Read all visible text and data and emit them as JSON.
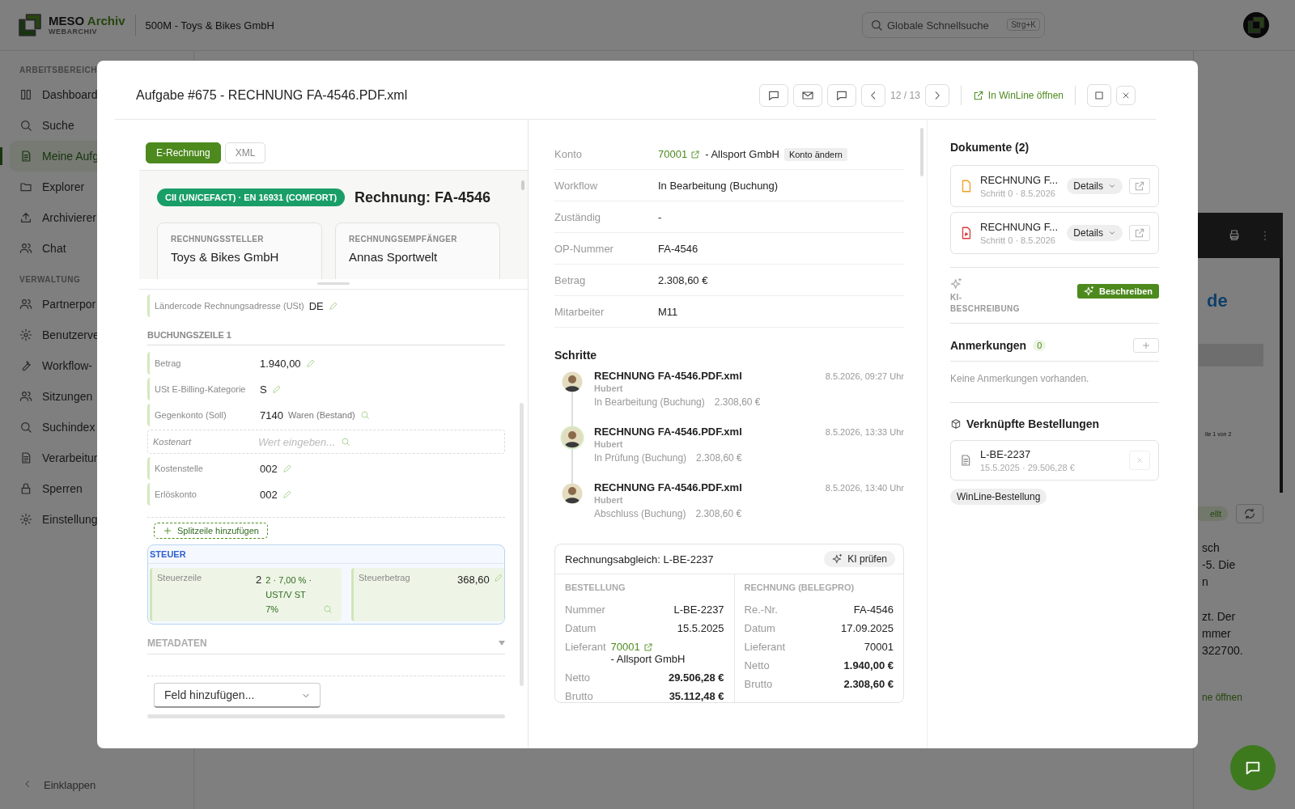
{
  "app": {
    "brand": "MESO",
    "brand_accent": "Archiv",
    "brand_sub": "WEBARCHIV",
    "tenant": "500M - Toys & Bikes GmbH",
    "search": {
      "placeholder": "Globale Schnellsuche",
      "shortcut": "Strg+K"
    }
  },
  "sidebar": {
    "sections": [
      {
        "title": "ARBEITSBEREICH",
        "items": [
          {
            "label": "Dashboard",
            "selected": false
          },
          {
            "label": "Suche",
            "selected": false
          },
          {
            "label": "Meine Aufg",
            "selected": true
          },
          {
            "label": "Explorer",
            "selected": false
          },
          {
            "label": "Archivierer",
            "selected": false
          },
          {
            "label": "Chat",
            "selected": false
          }
        ]
      },
      {
        "title": "VERWALTUNG",
        "items": [
          {
            "label": "Partnerpor",
            "selected": false
          },
          {
            "label": "Benutzerve",
            "selected": false
          },
          {
            "label": "Workflow-",
            "selected": false
          },
          {
            "label": "Sitzungen",
            "selected": false
          },
          {
            "label": "Suchindex",
            "selected": false
          },
          {
            "label": "Verarbeitur",
            "selected": false
          },
          {
            "label": "Sperren",
            "selected": false
          },
          {
            "label": "Einstellung",
            "selected": false
          }
        ]
      }
    ],
    "collapse": "Einklappen"
  },
  "background": {
    "pdf_heading": "de",
    "pdf_footer": "ite 1 von 2",
    "status": "ellt",
    "lines": [
      "sch",
      "-5. Die",
      "n",
      "zt. Der",
      "mmer",
      "322700."
    ],
    "link": "ne öffnen"
  },
  "dialog": {
    "title": "Aufgabe #675 - RECHNUNG FA-4546.PDF.xml",
    "pager": "12 / 13",
    "open_link": "In WinLine öffnen",
    "left": {
      "tabs": [
        {
          "label": "E-Rechnung",
          "selected": true
        },
        {
          "label": "XML",
          "selected": false
        }
      ],
      "standard": "CII (UN/CEFACT) · EN 16931 (COMFORT)",
      "heading": "Rechnung: FA-4546",
      "parties": [
        {
          "label": "RECHNUNGSSTELLER",
          "name": "Toys & Bikes GmbH"
        },
        {
          "label": "RECHNUNGSEMPFÄNGER",
          "name": "Annas Sportwelt"
        }
      ],
      "country": {
        "label": "Ländercode Rechnungsadresse (USt)",
        "value": "DE"
      },
      "booking_title": "BUCHUNGSZEILE 1",
      "fields": [
        {
          "kind": "edit",
          "label": "Betrag",
          "value": "1.940,00"
        },
        {
          "kind": "edit",
          "label": "USt E-Billing-Kategorie",
          "value": "S"
        },
        {
          "kind": "lookup",
          "label": "Gegenkonto (Soll)",
          "value": "7140",
          "note": "Waren (Bestand)"
        },
        {
          "kind": "empty",
          "label": "Kostenart",
          "placeholder": "Wert eingeben..."
        },
        {
          "kind": "edit",
          "label": "Kostenstelle",
          "value": "002"
        },
        {
          "kind": "edit",
          "label": "Erlöskonto",
          "value": "002"
        }
      ],
      "split_button": "Splitzeile hinzufügen",
      "tax": {
        "title": "STEUER",
        "cells": [
          {
            "kind": "lookup",
            "label": "Steuerzeile",
            "value": "2",
            "note": "2 · 7,00 % · UST/V ST 7%"
          },
          {
            "kind": "edit",
            "label": "Steuerbetrag",
            "value": "368,60"
          }
        ]
      },
      "metadata": "METADATEN",
      "add_field": {
        "placeholder": "Feld hinzufügen..."
      }
    },
    "middle": {
      "props": [
        {
          "kind": "account",
          "label": "Konto",
          "link": "70001",
          "value": "- Allsport GmbH",
          "action": "Konto ändern"
        },
        {
          "kind": "text",
          "label": "Workflow",
          "value": "In Bearbeitung (Buchung)"
        },
        {
          "kind": "text",
          "label": "Zuständig",
          "value": "-"
        },
        {
          "kind": "text",
          "label": "OP-Nummer",
          "value": "FA-4546"
        },
        {
          "kind": "text",
          "label": "Betrag",
          "value": "2.308,60 €"
        },
        {
          "kind": "text",
          "label": "Mitarbeiter",
          "value": "M11"
        }
      ],
      "steps_title": "Schritte",
      "steps": [
        {
          "title": "RECHNUNG FA-4546.PDF.xml",
          "user": "Hubert",
          "status": "In Bearbeitung (Buchung)",
          "amount": "2.308,60 €",
          "time": "8.5.2026, 09:27 Uhr",
          "highlighted": false
        },
        {
          "title": "RECHNUNG FA-4546.PDF.xml",
          "user": "Hubert",
          "status": "In Prüfung (Buchung)",
          "amount": "2.308,60 €",
          "time": "8.5.2026, 13:33 Uhr",
          "highlighted": true
        },
        {
          "title": "RECHNUNG FA-4546.PDF.xml",
          "user": "Hubert",
          "status": "Abschluss (Buchung)",
          "amount": "2.308,60 €",
          "time": "8.5.2026, 13:40 Uhr",
          "highlighted": false
        }
      ],
      "recon": {
        "title": "Rechnungsabgleich: L-BE-2237",
        "button": "KI prüfen",
        "columns": [
          {
            "title": "BESTELLUNG",
            "rows": [
              {
                "kind": "text",
                "label": "Nummer",
                "value": "L-BE-2237"
              },
              {
                "kind": "text",
                "label": "Datum",
                "value": "15.5.2025"
              },
              {
                "kind": "account",
                "label": "Lieferant",
                "link": "70001",
                "value": "- Allsport GmbH"
              },
              {
                "kind": "strong",
                "label": "Netto",
                "value": "29.506,28 €"
              },
              {
                "kind": "strong",
                "label": "Brutto",
                "value": "35.112,48 €"
              }
            ]
          },
          {
            "title": "RECHNUNG (BELEGPRO)",
            "rows": [
              {
                "kind": "text",
                "label": "Re.-Nr.",
                "value": "FA-4546"
              },
              {
                "kind": "text",
                "label": "Datum",
                "value": "17.09.2025"
              },
              {
                "kind": "text",
                "label": "Lieferant",
                "value": "70001"
              },
              {
                "kind": "strong",
                "label": "Netto",
                "value": "1.940,00 €"
              },
              {
                "kind": "strong",
                "label": "Brutto",
                "value": "2.308,60 €"
              }
            ]
          }
        ]
      }
    },
    "right": {
      "docs_title": "Dokumente (2)",
      "docs": [
        {
          "kind": "file",
          "name": "RECHNUNG F...",
          "meta": "Schritt 0 · 8.5.2026",
          "button": "Details"
        },
        {
          "kind": "pdf",
          "name": "RECHNUNG F...",
          "meta": "Schritt 0 · 8.5.2026",
          "button": "Details"
        }
      ],
      "ai_label": "KI-BESCHREIBUNG",
      "ai_button": "Beschreiben",
      "notes_title": "Anmerkungen",
      "notes_count": "0",
      "notes_empty": "Keine Anmerkungen vorhanden.",
      "orders_title": "Verknüpfte Bestellungen",
      "orders": [
        {
          "number": "L-BE-2237",
          "meta": "15.5.2025 · 29.506,28 €"
        }
      ],
      "order_tag": "WinLine-Bestellung"
    }
  }
}
